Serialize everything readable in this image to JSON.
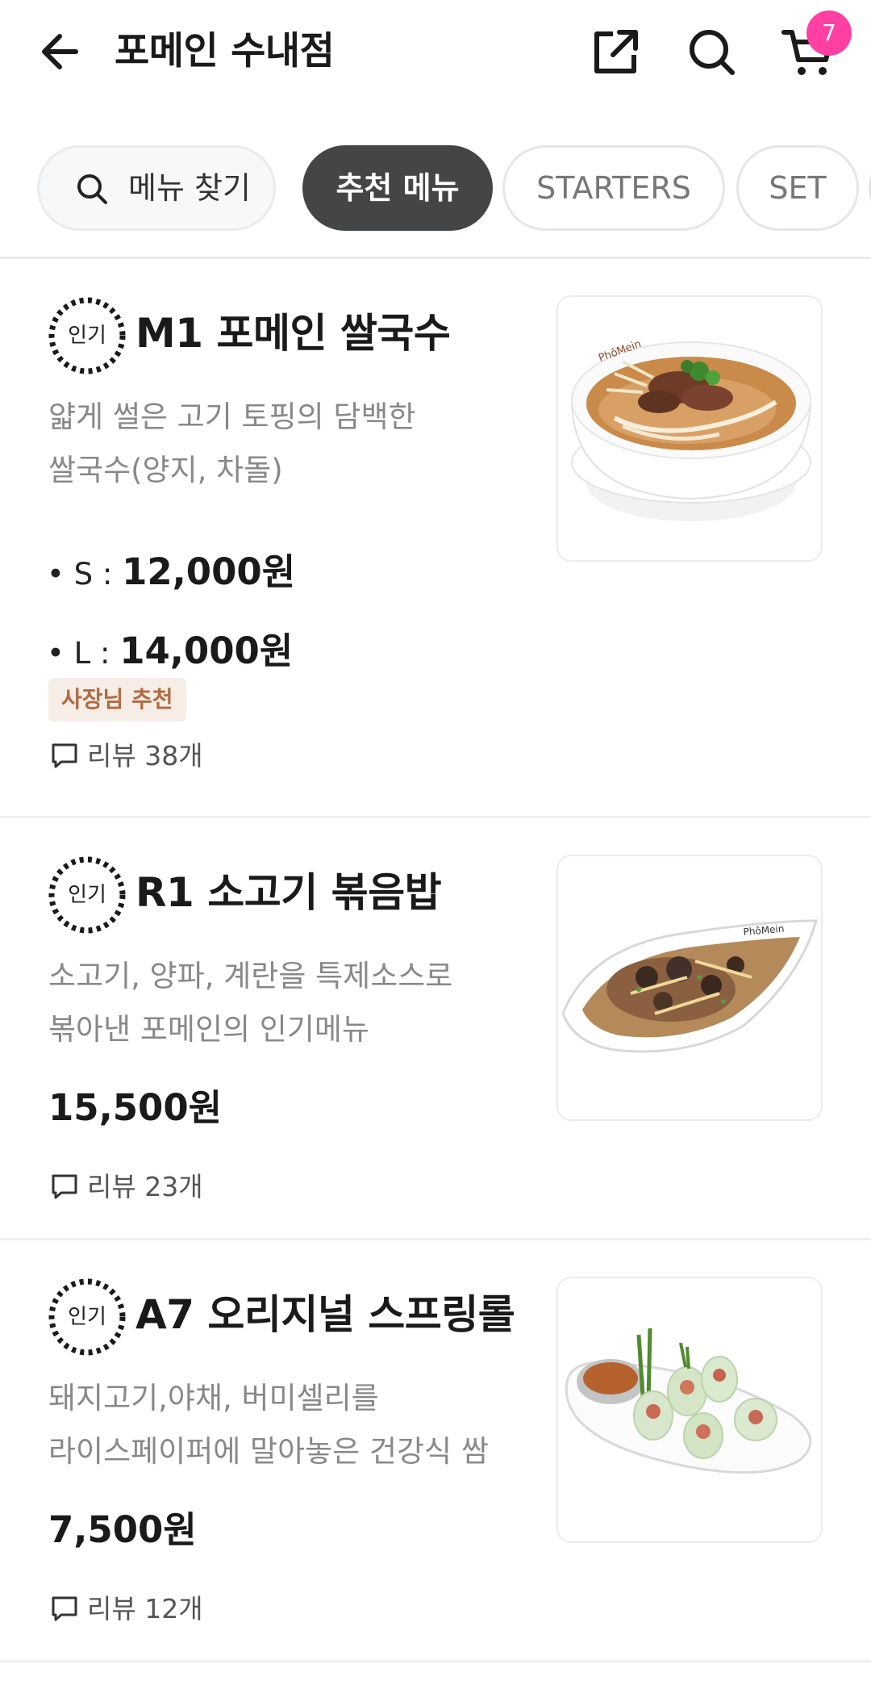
{
  "header": {
    "title": "포메인 수내점",
    "cart_count": "7",
    "icons": {
      "back": "arrow-left-icon",
      "share": "share-icon",
      "search": "search-icon",
      "cart": "cart-icon"
    },
    "badge_color": "#ff3fa2"
  },
  "chips": {
    "search_label": "메뉴 찾기",
    "categories": [
      "추천 메뉴",
      "STARTERS",
      "SET"
    ],
    "active_index": 0
  },
  "items": [
    {
      "badge": "인기",
      "name": "M1 포메인 쌀국수",
      "desc_lines": [
        "얇게 썰은 고기 토핑의 담백한",
        "쌀국수(양지, 차돌)"
      ],
      "prices": [
        {
          "label": "• S : ",
          "value": "12,000원"
        },
        {
          "label": "• L : ",
          "value": "14,000원"
        }
      ],
      "tag": "사장님 추천",
      "review": "리뷰 38개"
    },
    {
      "badge": "인기",
      "name": "R1 소고기 볶음밥",
      "desc_lines": [
        "소고기, 양파, 계란을 특제소스로",
        "볶아낸 포메인의 인기메뉴"
      ],
      "price": "15,500원",
      "review": "리뷰 23개"
    },
    {
      "badge": "인기",
      "name": "A7 오리지널 스프링롤",
      "desc_lines": [
        "돼지고기,야채, 버미셀리를",
        "라이스페이퍼에 말아놓은 건강식 쌈"
      ],
      "price": "7,500원",
      "review": "리뷰 12개"
    }
  ],
  "colors": {
    "active_chip": "#444546",
    "tag_bg": "#f6ede6",
    "tag_text": "#b06c43"
  }
}
